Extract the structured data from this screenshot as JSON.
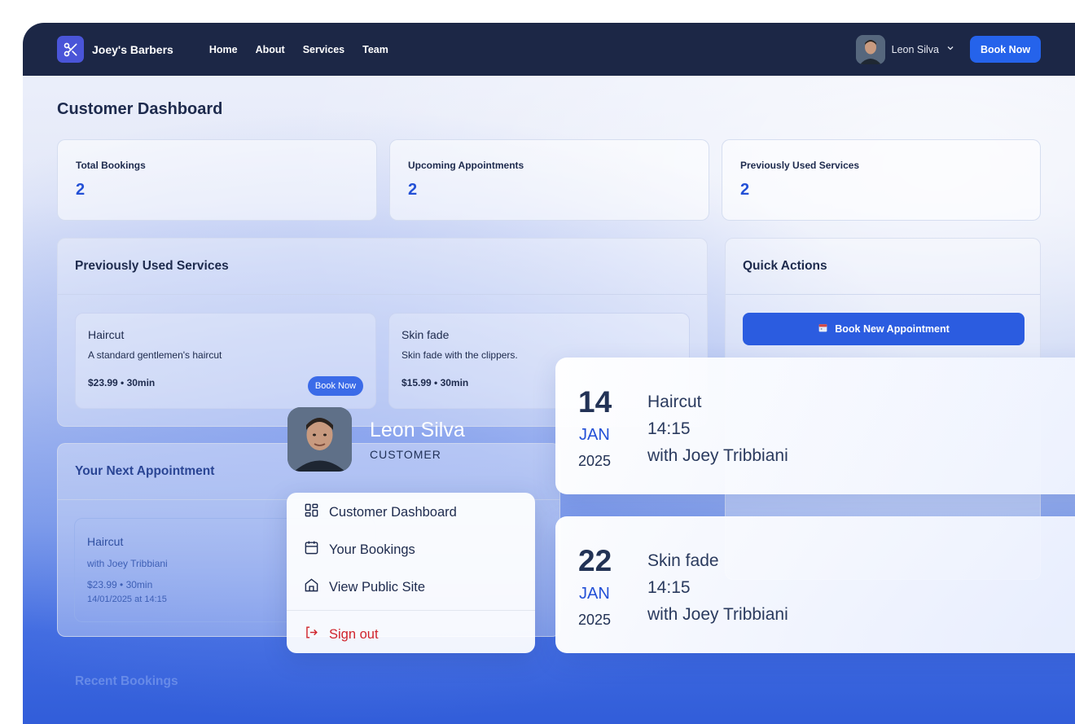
{
  "nav": {
    "brand": "Joey's Barbers",
    "links": [
      "Home",
      "About",
      "Services",
      "Team"
    ],
    "user": "Leon Silva",
    "book_label": "Book Now"
  },
  "page": {
    "title": "Customer Dashboard"
  },
  "stats": [
    {
      "label": "Total Bookings",
      "value": "2"
    },
    {
      "label": "Upcoming Appointments",
      "value": "2"
    },
    {
      "label": "Previously Used Services",
      "value": "2"
    }
  ],
  "services_panel": {
    "title": "Previously Used Services",
    "items": [
      {
        "name": "Haircut",
        "desc": "A standard gentlemen's haircut",
        "price": "$23.99 • 30min",
        "book_label": "Book Now"
      },
      {
        "name": "Skin fade",
        "desc": "Skin fade with the clippers.",
        "price": "$15.99 • 30min"
      }
    ]
  },
  "quick_actions": {
    "title": "Quick Actions",
    "book_new": "Book New Appointment"
  },
  "next_appt": {
    "title": "Your Next Appointment",
    "service": "Haircut",
    "barber": "with Joey Tribbiani",
    "price": "$23.99 • 30min",
    "datetime": "14/01/2025 at 14:15"
  },
  "recent": {
    "title": "Recent Bookings"
  },
  "user_popover": {
    "name": "Leon Silva",
    "role": "CUSTOMER",
    "menu": [
      "Customer Dashboard",
      "Your Bookings",
      "View Public Site"
    ],
    "signout": "Sign out"
  },
  "appointments": [
    {
      "day": "14",
      "month": "JAN",
      "year": "2025",
      "service": "Haircut",
      "time": "14:15",
      "barber": "with Joey Tribbiani"
    },
    {
      "day": "22",
      "month": "JAN",
      "year": "2025",
      "service": "Skin fade",
      "time": "14:15",
      "barber": "with Joey Tribbiani"
    }
  ],
  "colors": {
    "nav": "#1c2746",
    "accent": "#2563eb",
    "danger": "#d0232b"
  }
}
